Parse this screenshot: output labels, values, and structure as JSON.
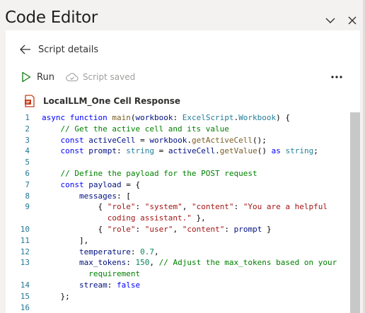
{
  "header": {
    "title": "Code Editor"
  },
  "nav": {
    "back_label": "Script details"
  },
  "toolbar": {
    "run_label": "Run",
    "saved_label": "Script saved",
    "more_label": "..."
  },
  "file": {
    "name": "LocalLLM_One Cell Response"
  },
  "code": {
    "line_numbers": [
      "1",
      "2",
      "3",
      "4",
      "5",
      "6",
      "7",
      "8",
      "9",
      "",
      "10",
      "11",
      "12",
      "13",
      "",
      "14",
      "15",
      "16"
    ]
  },
  "colors": {
    "keyword": "#0000ff",
    "comment": "#008000",
    "string": "#a31515",
    "number": "#098658",
    "linenum": "#237893",
    "accent": "#107c10"
  }
}
